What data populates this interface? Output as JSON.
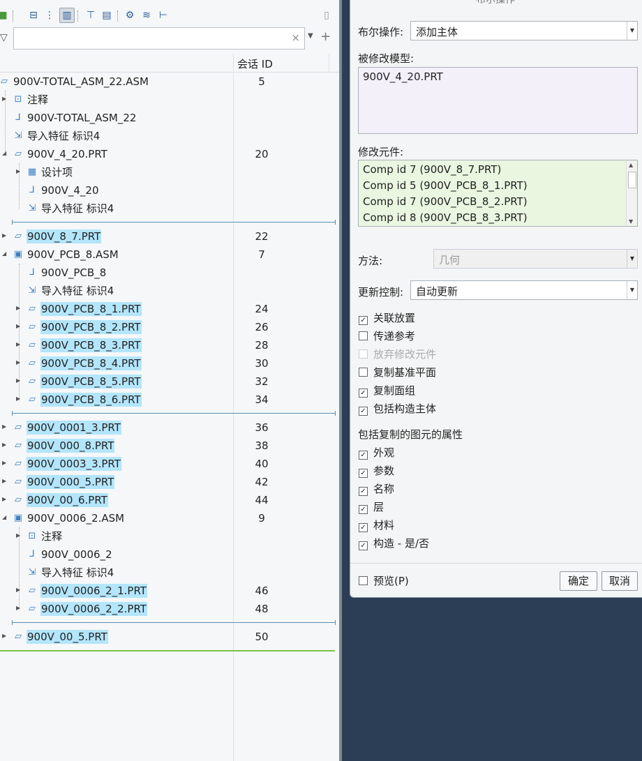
{
  "tree": {
    "search_placeholder": "",
    "column_session_id": "会话 ID",
    "rows": [
      {
        "label": "900V-TOTAL_ASM_22.ASM",
        "sid": "5",
        "sel": false
      },
      {
        "label": "注释",
        "sid": "",
        "sel": false
      },
      {
        "label": "900V-TOTAL_ASM_22",
        "sid": "",
        "sel": false
      },
      {
        "label": "导入特征 标识4",
        "sid": "",
        "sel": false
      },
      {
        "label": "900V_4_20.PRT",
        "sid": "20",
        "sel": false
      },
      {
        "label": "设计项",
        "sid": "",
        "sel": false
      },
      {
        "label": "900V_4_20",
        "sid": "",
        "sel": false
      },
      {
        "label": "导入特征 标识4",
        "sid": "",
        "sel": false
      },
      {
        "label": "900V_8_7.PRT",
        "sid": "22",
        "sel": true
      },
      {
        "label": "900V_PCB_8.ASM",
        "sid": "7",
        "sel": false
      },
      {
        "label": "900V_PCB_8",
        "sid": "",
        "sel": false
      },
      {
        "label": "导入特征 标识4",
        "sid": "",
        "sel": false
      },
      {
        "label": "900V_PCB_8_1.PRT",
        "sid": "24",
        "sel": true
      },
      {
        "label": "900V_PCB_8_2.PRT",
        "sid": "26",
        "sel": true
      },
      {
        "label": "900V_PCB_8_3.PRT",
        "sid": "28",
        "sel": true
      },
      {
        "label": "900V_PCB_8_4.PRT",
        "sid": "30",
        "sel": true
      },
      {
        "label": "900V_PCB_8_5.PRT",
        "sid": "32",
        "sel": true
      },
      {
        "label": "900V_PCB_8_6.PRT",
        "sid": "34",
        "sel": true
      },
      {
        "label": "900V_0001_3.PRT",
        "sid": "36",
        "sel": true
      },
      {
        "label": "900V_000_8.PRT",
        "sid": "38",
        "sel": true
      },
      {
        "label": "900V_0003_3.PRT",
        "sid": "40",
        "sel": true
      },
      {
        "label": "900V_000_5.PRT",
        "sid": "42",
        "sel": true
      },
      {
        "label": "900V_00_6.PRT",
        "sid": "44",
        "sel": true
      },
      {
        "label": "900V_0006_2.ASM",
        "sid": "9",
        "sel": false
      },
      {
        "label": "注释",
        "sid": "",
        "sel": false
      },
      {
        "label": "900V_0006_2",
        "sid": "",
        "sel": false
      },
      {
        "label": "导入特征 标识4",
        "sid": "",
        "sel": false
      },
      {
        "label": "900V_0006_2_1.PRT",
        "sid": "46",
        "sel": true
      },
      {
        "label": "900V_0006_2_2.PRT",
        "sid": "48",
        "sel": true
      },
      {
        "label": "900V_00_5.PRT",
        "sid": "50",
        "sel": true
      }
    ]
  },
  "dialog": {
    "title": "布尔操作",
    "bool_op_label": "布尔操作:",
    "bool_op_value": "添加主体",
    "modified_model_label": "被修改模型:",
    "modified_model_value": "900V_4_20.PRT",
    "modify_comp_label": "修改元件:",
    "components": [
      "Comp id 7 (900V_8_7.PRT)",
      "Comp id 5 (900V_PCB_8_1.PRT)",
      "Comp id 7 (900V_PCB_8_2.PRT)",
      "Comp id 8 (900V_PCB_8_3.PRT)"
    ],
    "method_label": "方法:",
    "method_value": "几何",
    "update_label": "更新控制:",
    "update_value": "自动更新",
    "options": [
      {
        "label": "关联放置",
        "checked": true,
        "disabled": false
      },
      {
        "label": "传递参考",
        "checked": false,
        "disabled": false
      },
      {
        "label": "放弃修改元件",
        "checked": false,
        "disabled": true
      },
      {
        "label": "复制基准平面",
        "checked": false,
        "disabled": false
      },
      {
        "label": "复制面组",
        "checked": true,
        "disabled": false
      },
      {
        "label": "包括构造主体",
        "checked": true,
        "disabled": false
      }
    ],
    "props_label": "包括复制的图元的属性",
    "props": [
      {
        "label": "外观",
        "checked": true
      },
      {
        "label": "参数",
        "checked": true
      },
      {
        "label": "名称",
        "checked": true
      },
      {
        "label": "层",
        "checked": true
      },
      {
        "label": "材料",
        "checked": true
      },
      {
        "label": "构造 - 是/否",
        "checked": true
      }
    ],
    "preview_label": "预览(P)",
    "ok_label": "确定",
    "cancel_label": "取消"
  }
}
